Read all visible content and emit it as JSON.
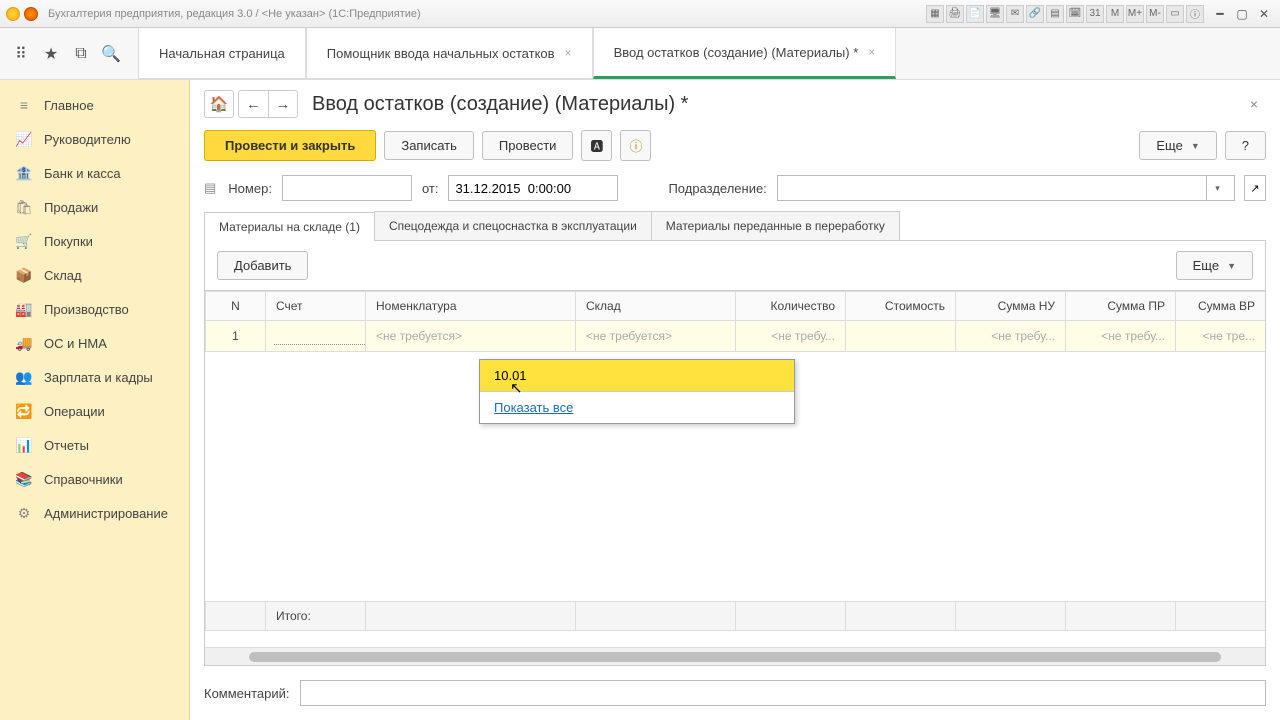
{
  "title_bar": {
    "text": "Бухгалтерия предприятия, редакция 3.0 / <Не указан> (1С:Предприятие)",
    "icons": [
      "📄",
      "🖨",
      "📋",
      "🗂",
      "✉",
      "🔗",
      "📊",
      "🗓",
      "31",
      "М",
      "М+",
      "М-",
      "▭",
      "ⓘ"
    ]
  },
  "view_icons": [
    "⠿",
    "★",
    "⧉",
    "🔍"
  ],
  "tabs": [
    {
      "label": "Начальная страница",
      "closable": false
    },
    {
      "label": "Помощник ввода начальных остатков",
      "closable": true
    },
    {
      "label": "Ввод остатков (создание) (Материалы) *",
      "closable": true,
      "active": true
    }
  ],
  "sidebar": [
    {
      "icon": "≡",
      "label": "Главное"
    },
    {
      "icon": "📈",
      "label": "Руководителю"
    },
    {
      "icon": "🏦",
      "label": "Банк и касса"
    },
    {
      "icon": "🛍",
      "label": "Продажи"
    },
    {
      "icon": "🛒",
      "label": "Покупки"
    },
    {
      "icon": "📦",
      "label": "Склад"
    },
    {
      "icon": "🏭",
      "label": "Производство"
    },
    {
      "icon": "🚚",
      "label": "ОС и НМА"
    },
    {
      "icon": "👥",
      "label": "Зарплата и кадры"
    },
    {
      "icon": "🔁",
      "label": "Операции"
    },
    {
      "icon": "📊",
      "label": "Отчеты"
    },
    {
      "icon": "📚",
      "label": "Справочники"
    },
    {
      "icon": "⚙",
      "label": "Администрирование"
    }
  ],
  "page": {
    "title": "Ввод остатков (создание) (Материалы) *",
    "nav": {
      "home": "🏠",
      "back": "←",
      "fwd": "→"
    },
    "toolbar": {
      "primary": "Провести и закрыть",
      "record": "Записать",
      "post": "Провести",
      "more": "Еще",
      "help": "?"
    },
    "form": {
      "number_label": "Номер:",
      "number_value": "",
      "from_label": "от:",
      "date_value": "31.12.2015  0:00:00",
      "department_label": "Подразделение:",
      "department_value": ""
    },
    "subtabs": [
      {
        "label": "Материалы на складе (1)",
        "active": true
      },
      {
        "label": "Спецодежда и спецоснастка в эксплуатации"
      },
      {
        "label": "Материалы переданные в переработку"
      }
    ],
    "table": {
      "add": "Добавить",
      "more": "Еще",
      "columns": [
        "N",
        "Счет",
        "Номенклатура",
        "Склад",
        "Количество",
        "Стоимость",
        "Сумма НУ",
        "Сумма ПР",
        "Сумма ВР"
      ],
      "row": {
        "n": "1",
        "acc_value": "",
        "nom": "<не требуется>",
        "skl": "<не требуется>",
        "qty": "<не требу...",
        "nu": "<не требу...",
        "pr": "<не требу...",
        "vr": "<не тре..."
      },
      "footer_label": "Итого:"
    },
    "dropdown": {
      "item": "10.01",
      "show_all": "Показать все"
    },
    "comment_label": "Комментарий:",
    "comment_value": ""
  }
}
